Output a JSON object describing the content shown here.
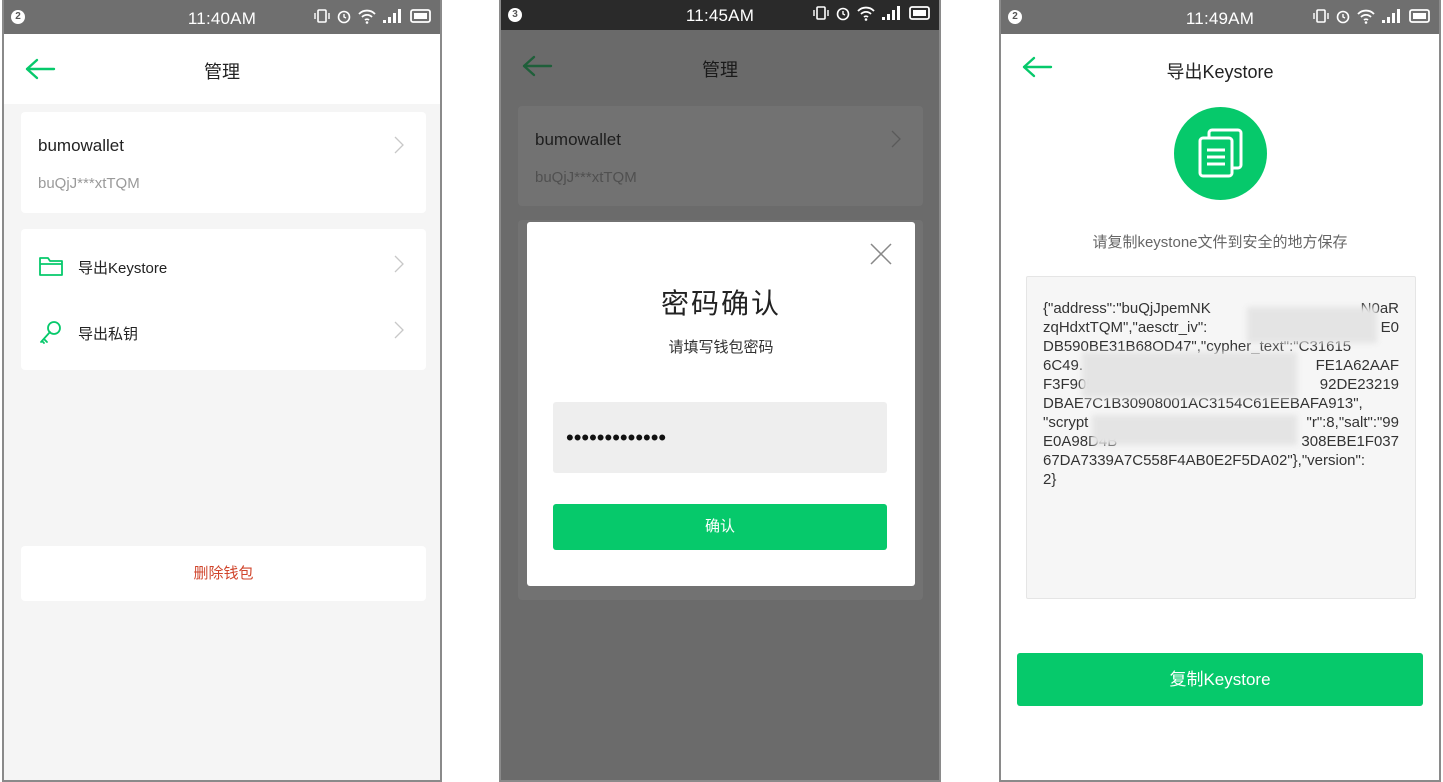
{
  "colors": {
    "accent": "#06c96b",
    "danger": "#d0452c",
    "statusbar": "#6f6f6f"
  },
  "screen1": {
    "status": {
      "notif": "2",
      "time": "11:40AM"
    },
    "nav": {
      "title": "管理",
      "back_icon": "arrow-left-icon"
    },
    "account": {
      "name": "bumowallet",
      "address": "buQjJ***xtTQM"
    },
    "menu": [
      {
        "label": "导出Keystore",
        "icon": "folder-icon"
      },
      {
        "label": "导出私钥",
        "icon": "key-icon"
      }
    ],
    "delete_label": "删除钱包"
  },
  "screen2": {
    "status": {
      "notif": "3",
      "time": "11:45AM"
    },
    "nav": {
      "title": "管理"
    },
    "account": {
      "name": "bumowallet",
      "address": "buQjJ***xtTQM"
    },
    "dialog": {
      "title": "密码确认",
      "subtitle": "请填写钱包密码",
      "password_value": "•••••••••••••",
      "confirm_label": "确认"
    }
  },
  "screen3": {
    "status": {
      "notif": "2",
      "time": "11:49AM"
    },
    "nav": {
      "title": "导出Keystore"
    },
    "hint": "请复制keystone文件到安全的地方保存",
    "keystore_lines": [
      "{\"address\":\"buQjJpemNK",
      "zqHdxtTQM\",\"aesctr_iv\":",
      "DB590BE31B68OD47\",\"cypher_text\":\"C31615",
      "6C49.",
      "F3F905709232E1289A5E01",
      "DBAE7C1B30908001AC3154C61EEBAFA913\",",
      "\"scrypt",
      "E0A98D4B",
      "67DA7339A7C558F4AB0E2F5DA02\"},\"version\":",
      "2}"
    ],
    "keystore_right": [
      "N0aR",
      "E0",
      "",
      "FE1A62AAF",
      "92DE23219",
      "",
      "\"r\":8,\"salt\":\"99",
      "308EBE1F037"
    ],
    "copy_label": "复制Keystore"
  }
}
